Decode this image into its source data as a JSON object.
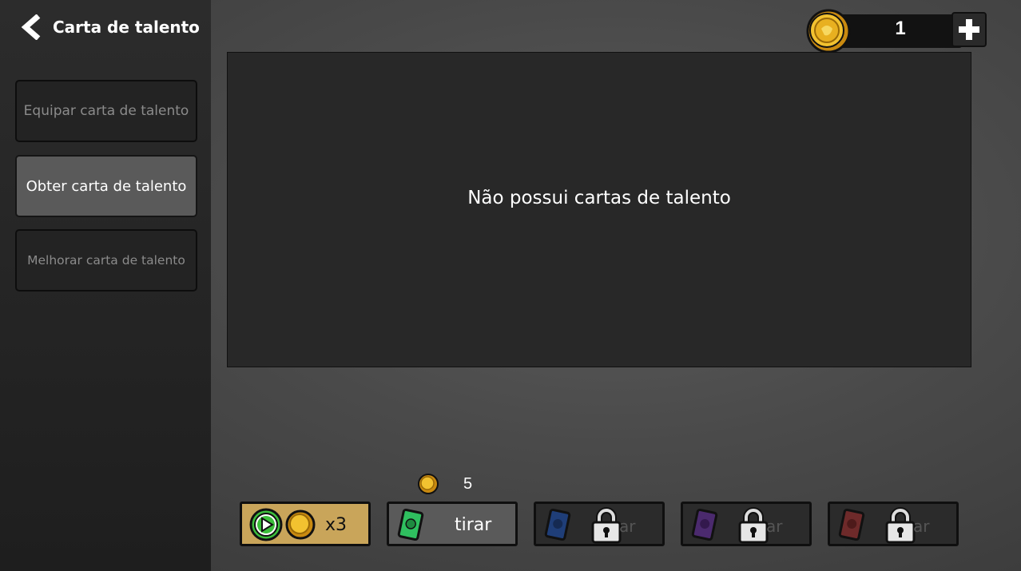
{
  "header": {
    "back_label": "Carta de talento"
  },
  "sidebar": {
    "items": [
      {
        "label": "Equipar carta de talento"
      },
      {
        "label": "Obter carta de talento"
      },
      {
        "label": "Melhorar carta de talento"
      }
    ]
  },
  "currency": {
    "count": "1"
  },
  "panel": {
    "message": "Não possui cartas de talento"
  },
  "draw": {
    "cost": "5",
    "ad_label": "x3",
    "buttons": [
      {
        "label": "tirar",
        "card_color": "#2fbf5f",
        "locked": false
      },
      {
        "label": "ar",
        "card_color": "#1f3e78",
        "locked": true
      },
      {
        "label": "ar",
        "card_color": "#4b2a6e",
        "locked": true
      },
      {
        "label": "ar",
        "card_color": "#6e2a2a",
        "locked": true
      }
    ]
  },
  "colors": {
    "accent_gold": "#c9a55a",
    "coin": "#f2c230",
    "play_green": "#3cbf3c"
  }
}
